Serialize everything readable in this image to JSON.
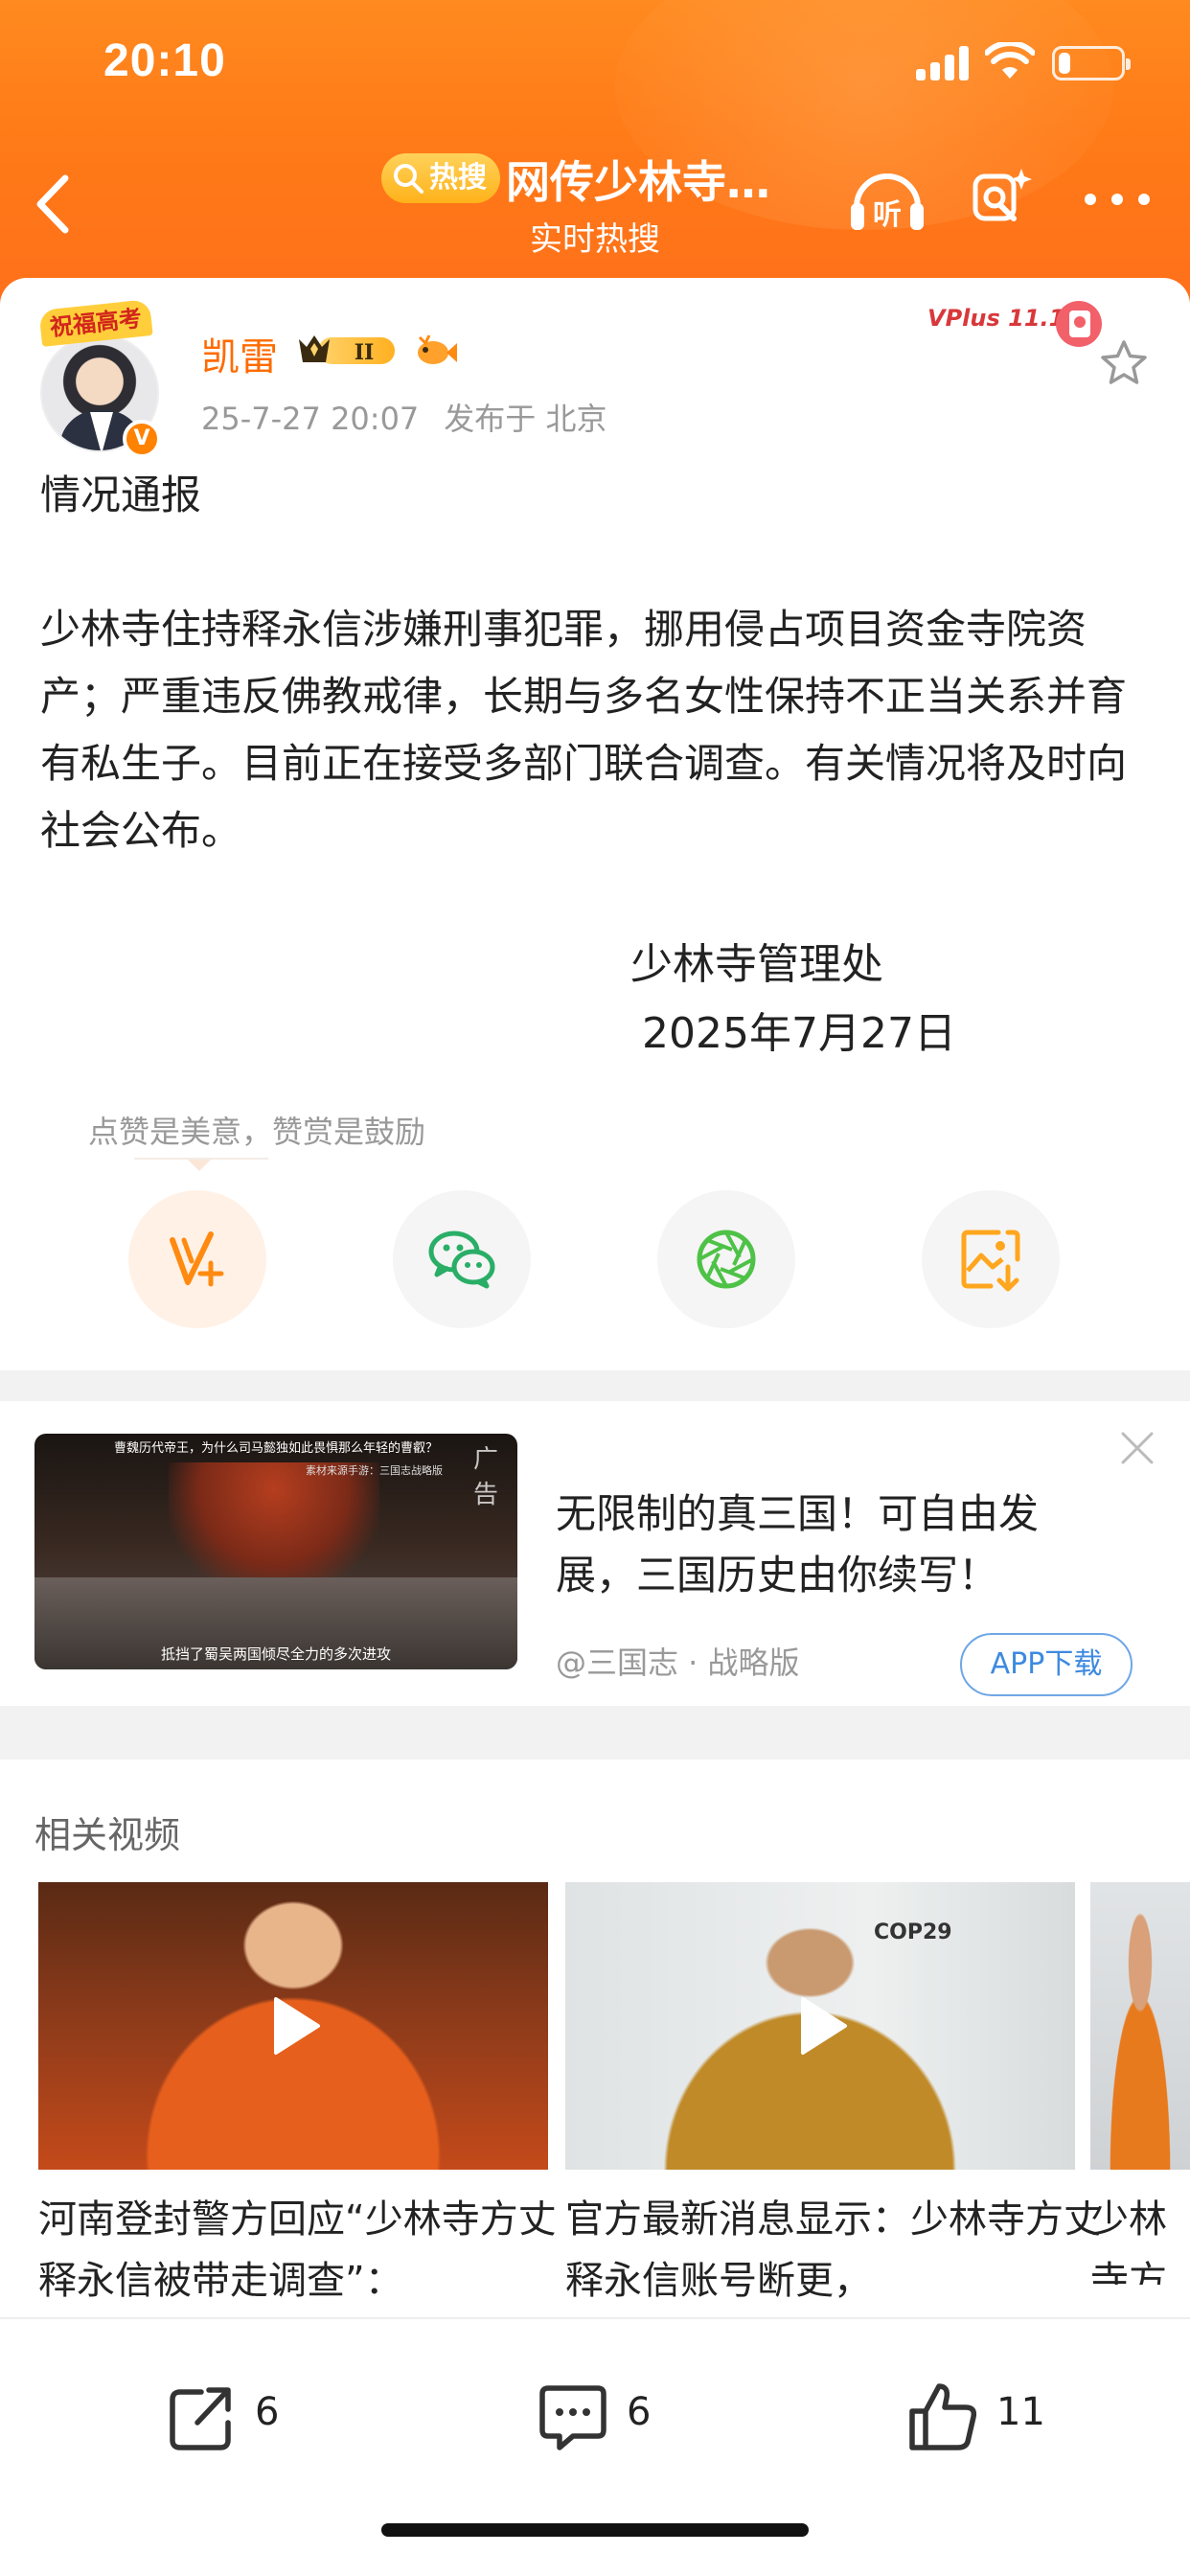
{
  "status_bar": {
    "time": "20:10",
    "battery_level": 0.2
  },
  "nav": {
    "hot_badge": "热搜",
    "title": "网传少林寺…",
    "subtitle": "实时热搜",
    "listen_label": "听"
  },
  "colors": {
    "brand_orange": "#ff7a18",
    "link_blue": "#3d8ae0",
    "author_orange": "#ff6b00"
  },
  "post": {
    "avatar_ribbon": "祝福高考",
    "author": "凯雷",
    "level": "II",
    "vplus_badge": "VPlus 11.11",
    "timestamp": "25-7-27 20:07",
    "location": "发布于 北京",
    "heading": "情况通报",
    "body": "少林寺住持释永信涉嫌刑事犯罪，挪用侵占项目资金寺院资产；严重违反佛教戒律，长期与多名女性保持不正当关系并育有私生子。目前正在接受多部门联合调查。有关情况将及时向社会公布。",
    "sign_org": "少林寺管理处",
    "sign_date": "2025年7月27日",
    "tip": "点赞是美意，赞赏是鼓励",
    "actions": [
      {
        "name": "reward",
        "icon": "v-plus-icon"
      },
      {
        "name": "wechat",
        "icon": "wechat-icon"
      },
      {
        "name": "moments",
        "icon": "aperture-icon"
      },
      {
        "name": "save-image",
        "icon": "image-download-icon"
      }
    ]
  },
  "ad": {
    "thumb_top_text": "曹魏历代帝王，为什么司马懿独如此畏惧那么年轻的曹叡？",
    "thumb_source_text": "素材来源手游：三国志战略版",
    "thumb_caption": "抵挡了蜀吴两国倾尽全力的多次进攻",
    "label": "广告",
    "title": "无限制的真三国！可自由发展，三国历史由你续写！",
    "source": "@三国志 · 战略版",
    "download_button": "APP下载"
  },
  "related": {
    "title": "相关视频",
    "videos": [
      {
        "caption": "河南登封警方回应“少林寺方丈释永信被带走调查”："
      },
      {
        "caption": "官方最新消息显示：少林寺方丈释永信账号断更，",
        "thumb_text": "COP29"
      },
      {
        "caption": "少林寺方丈释永信被带走"
      }
    ]
  },
  "bottom_bar": {
    "repost_count": "6",
    "comment_count": "6",
    "like_count": "11"
  }
}
